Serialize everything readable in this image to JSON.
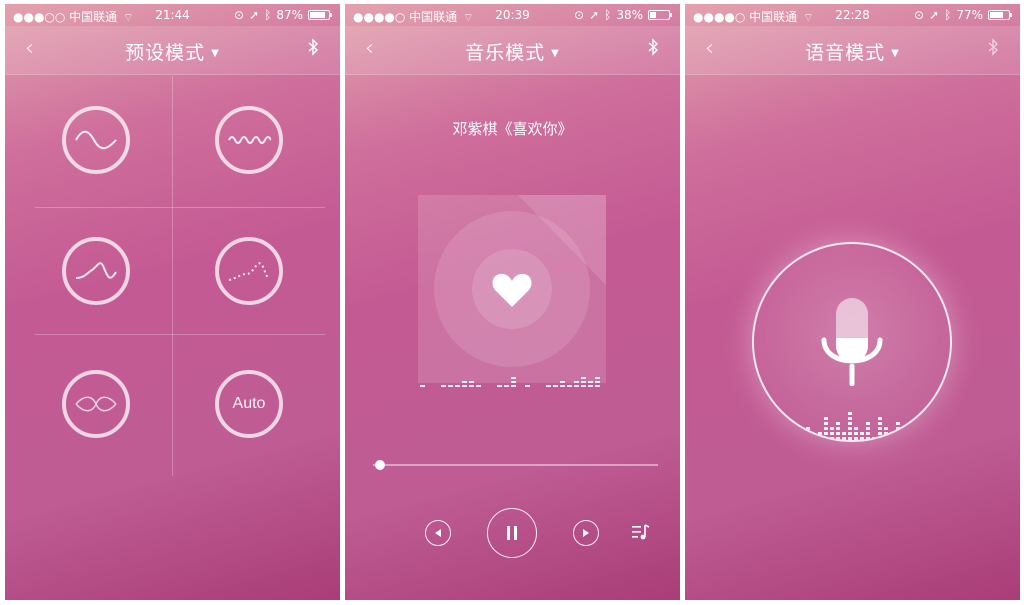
{
  "screens": [
    {
      "status": {
        "carrier": "●●●○○ 中国联通",
        "time": "21:44",
        "battery": "87%",
        "battery_level": 0.87
      },
      "nav": {
        "back": "‹",
        "title": "预设模式"
      },
      "modes": [
        {
          "icon": "sine-wave-icon"
        },
        {
          "icon": "dense-wave-icon"
        },
        {
          "icon": "rising-wave-icon"
        },
        {
          "icon": "dotted-wave-icon"
        },
        {
          "icon": "double-wave-icon"
        },
        {
          "icon": "auto-icon",
          "label": "Auto"
        }
      ]
    },
    {
      "status": {
        "carrier": "●●●●○ 中国联通",
        "time": "20:39",
        "battery": "38%",
        "battery_level": 0.38
      },
      "nav": {
        "back": "‹",
        "title": "音乐模式"
      },
      "song": "邓紫棋《喜欢你》",
      "progress": 0.04,
      "controls": [
        "previous-icon",
        "pause-icon",
        "next-icon",
        "playlist-icon"
      ]
    },
    {
      "status": {
        "carrier": "●●●●○ 中国联通",
        "time": "22:28",
        "battery": "77%",
        "battery_level": 0.77
      },
      "nav": {
        "back": "‹",
        "title": "语音模式"
      }
    }
  ],
  "colors": {
    "accent": "#c45a93",
    "top": "#e3a2ae",
    "bottom": "#a93d78"
  }
}
